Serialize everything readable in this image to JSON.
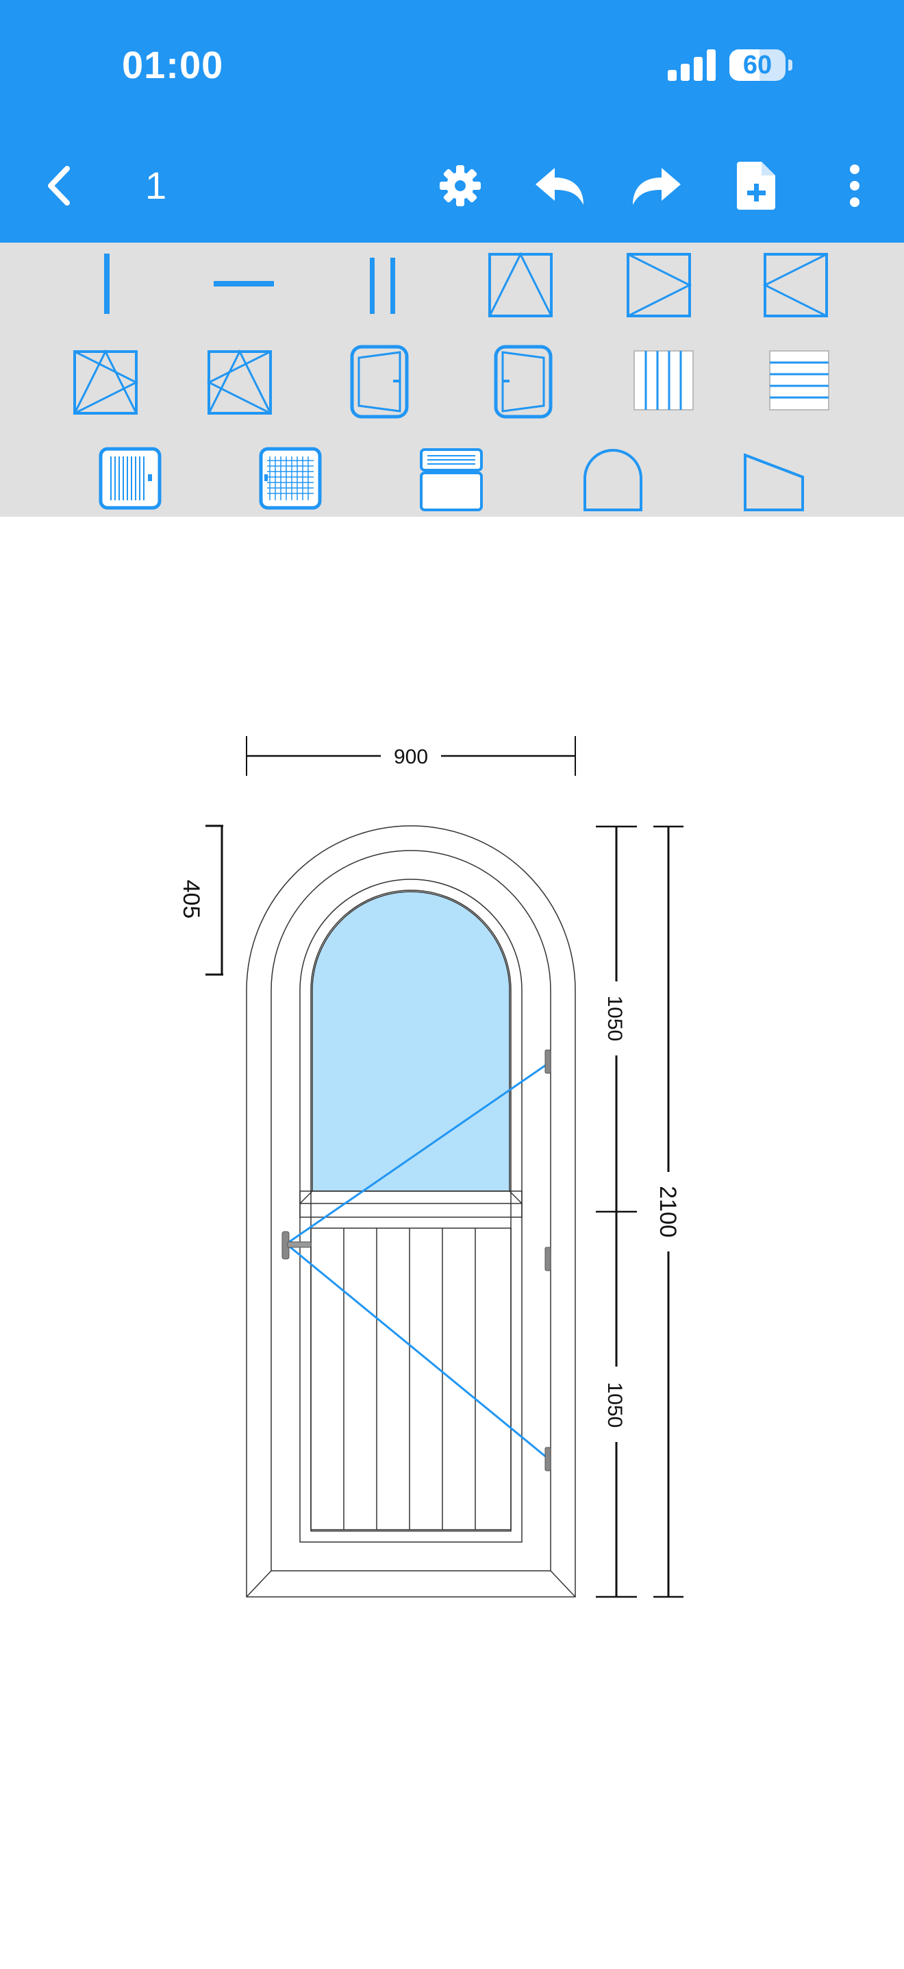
{
  "status_bar": {
    "time": "01:00",
    "battery": "60"
  },
  "toolbar": {
    "page_number": "1",
    "icons": [
      "back-chevron-icon",
      "gear-icon",
      "undo-icon",
      "redo-icon",
      "add-file-icon",
      "more-vertical-icon"
    ]
  },
  "palette": {
    "tools": [
      "vertical-mullion",
      "horizontal-transom",
      "double-mullion",
      "tilt-sash",
      "sash-opening-right",
      "sash-opening-left",
      "tilt-turn-right",
      "tilt-turn-left",
      "door-opening-left",
      "door-opening-right",
      "vertical-panel",
      "horizontal-panel",
      "roller-blind",
      "mosquito-net",
      "roller-shutter-box",
      "arch-shape",
      "trapezoid-shape"
    ]
  },
  "drawing": {
    "dimensions": {
      "width": "900",
      "arch_height": "405",
      "upper_height": "1050",
      "lower_height": "1050",
      "total_height": "2100"
    },
    "colors": {
      "glass": "#b3e0fb",
      "opening_lines": "#2196f3",
      "dimension_lines": "#111111"
    }
  }
}
